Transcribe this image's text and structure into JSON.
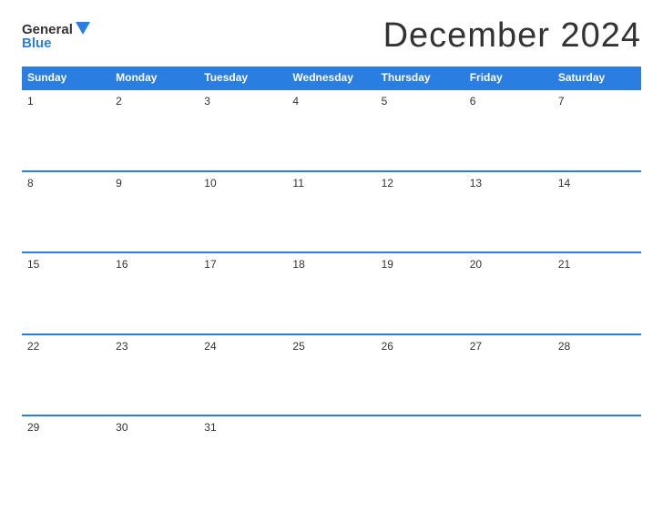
{
  "header": {
    "logo": {
      "general": "General",
      "blue": "Blue",
      "triangle_color": "#2a7de1"
    },
    "title": "December 2024"
  },
  "calendar": {
    "days_of_week": [
      "Sunday",
      "Monday",
      "Tuesday",
      "Wednesday",
      "Thursday",
      "Friday",
      "Saturday"
    ],
    "weeks": [
      [
        1,
        2,
        3,
        4,
        5,
        6,
        7
      ],
      [
        8,
        9,
        10,
        11,
        12,
        13,
        14
      ],
      [
        15,
        16,
        17,
        18,
        19,
        20,
        21
      ],
      [
        22,
        23,
        24,
        25,
        26,
        27,
        28
      ],
      [
        29,
        30,
        31,
        null,
        null,
        null,
        null
      ]
    ]
  }
}
